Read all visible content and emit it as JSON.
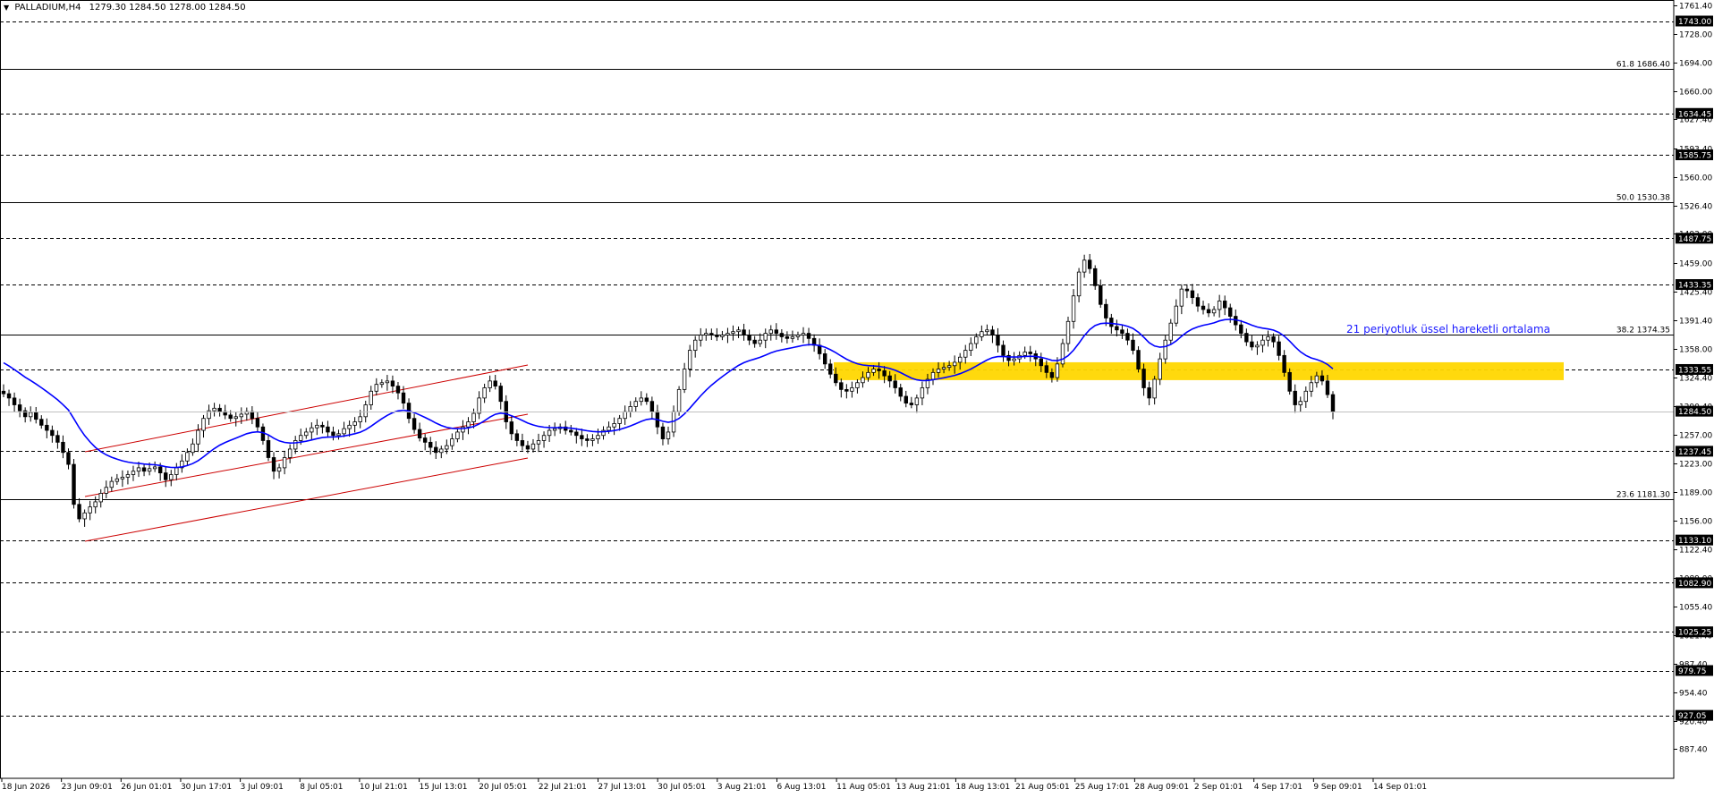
{
  "header": {
    "symbol": "PALLADIUM,H4",
    "ohlc": "1279.30 1284.50 1278.00 1284.50"
  },
  "colors": {
    "candle": "#000000",
    "ema": "#0000ff",
    "channel": "#cc0000",
    "zone": "#ffd700",
    "annotation": "#1a1aff",
    "last_price_line": "#c0c0c0"
  },
  "annotation_text": "21 periyotluk üssel hareketli ortalama",
  "chart_data": {
    "type": "candlestick",
    "ylim": [
      861.5,
      1761.4
    ],
    "yticks": [
      1761.4,
      1728.0,
      1694.0,
      1660.0,
      1627.4,
      1593.4,
      1560.0,
      1526.4,
      1493.0,
      1459.0,
      1425.4,
      1391.4,
      1358.0,
      1324.4,
      1290.4,
      1257.0,
      1223.0,
      1189.0,
      1156.0,
      1122.4,
      1089.0,
      1055.4,
      1021.4,
      987.4,
      954.4,
      920.4,
      887.4
    ],
    "x_labels": [
      "18 Jun 2026",
      "23 Jun 09:01",
      "26 Jun 01:01",
      "30 Jun 17:01",
      "3 Jul 09:01",
      "8 Jul 05:01",
      "10 Jul 21:01",
      "15 Jul 13:01",
      "20 Jul 05:01",
      "22 Jul 21:01",
      "27 Jul 13:01",
      "30 Jul 05:01",
      "3 Aug 21:01",
      "6 Aug 13:01",
      "11 Aug 05:01",
      "13 Aug 21:01",
      "18 Aug 13:01",
      "21 Aug 05:01",
      "25 Aug 17:01",
      "28 Aug 09:01",
      "2 Sep 01:01",
      "4 Sep 17:01",
      "9 Sep 09:01",
      "14 Sep 01:01"
    ],
    "last_price": 1284.5,
    "fib_levels": [
      {
        "label": "61.8 1686.40",
        "value": 1686.4
      },
      {
        "label": "50.0 1530.38",
        "value": 1530.38
      },
      {
        "label": "38.2 1374.35",
        "value": 1374.35
      },
      {
        "label": "23.6 1181.30",
        "value": 1181.3
      }
    ],
    "sr_levels": [
      {
        "label": "1743.00",
        "value": 1743.0
      },
      {
        "label": "1634.45",
        "value": 1634.45
      },
      {
        "label": "1585.75",
        "value": 1585.75
      },
      {
        "label": "1487.75",
        "value": 1487.75
      },
      {
        "label": "1433.35",
        "value": 1433.35
      },
      {
        "label": "1333.55",
        "value": 1333.55
      },
      {
        "label": "1237.45",
        "value": 1237.45
      },
      {
        "label": "1133.10",
        "value": 1133.1
      },
      {
        "label": "1082.90",
        "value": 1082.9
      },
      {
        "label": "1025.25",
        "value": 1025.25
      },
      {
        "label": "979.75",
        "value": 979.75
      },
      {
        "label": "927.05",
        "value": 927.05
      }
    ],
    "zone": {
      "y_from": 1321,
      "y_to": 1342
    },
    "series_close": [
      1305,
      1300,
      1292,
      1285,
      1278,
      1283,
      1275,
      1268,
      1262,
      1256,
      1248,
      1236,
      1222,
      1175,
      1158,
      1165,
      1172,
      1178,
      1188,
      1195,
      1202,
      1205,
      1207,
      1210,
      1214,
      1218,
      1214,
      1217,
      1219,
      1212,
      1204,
      1210,
      1218,
      1226,
      1236,
      1246,
      1262,
      1276,
      1285,
      1288,
      1284,
      1280,
      1276,
      1278,
      1281,
      1284,
      1276,
      1266,
      1250,
      1230,
      1214,
      1218,
      1230,
      1240,
      1250,
      1256,
      1260,
      1265,
      1268,
      1266,
      1260,
      1256,
      1258,
      1264,
      1268,
      1272,
      1278,
      1292,
      1308,
      1316,
      1318,
      1320,
      1314,
      1306,
      1294,
      1276,
      1263,
      1253,
      1248,
      1242,
      1236,
      1240,
      1244,
      1252,
      1260,
      1266,
      1272,
      1282,
      1300,
      1312,
      1320,
      1314,
      1296,
      1272,
      1258,
      1250,
      1244,
      1240,
      1246,
      1250,
      1256,
      1262,
      1264,
      1266,
      1262,
      1260,
      1256,
      1252,
      1250,
      1252,
      1256,
      1262,
      1266,
      1270,
      1276,
      1284,
      1290,
      1296,
      1300,
      1296,
      1284,
      1266,
      1252,
      1260,
      1284,
      1310,
      1334,
      1356,
      1368,
      1374,
      1376,
      1374,
      1372,
      1374,
      1376,
      1378,
      1380,
      1374,
      1368,
      1364,
      1368,
      1376,
      1380,
      1376,
      1372,
      1370,
      1372,
      1374,
      1376,
      1370,
      1362,
      1352,
      1340,
      1328,
      1318,
      1310,
      1308,
      1312,
      1318,
      1324,
      1330,
      1334,
      1332,
      1326,
      1320,
      1312,
      1302,
      1294,
      1292,
      1300,
      1312,
      1322,
      1330,
      1334,
      1336,
      1338,
      1342,
      1348,
      1356,
      1364,
      1372,
      1378,
      1380,
      1374,
      1362,
      1350,
      1344,
      1346,
      1350,
      1354,
      1352,
      1346,
      1338,
      1330,
      1324,
      1340,
      1364,
      1390,
      1420,
      1448,
      1462,
      1452,
      1432,
      1410,
      1394,
      1384,
      1380,
      1376,
      1368,
      1356,
      1334,
      1312,
      1300,
      1322,
      1346,
      1368,
      1388,
      1408,
      1428,
      1426,
      1418,
      1408,
      1404,
      1400,
      1404,
      1414,
      1406,
      1396,
      1386,
      1376,
      1366,
      1360,
      1362,
      1368,
      1372,
      1366,
      1350,
      1330,
      1308,
      1292,
      1296,
      1308,
      1318,
      1326,
      1320,
      1304,
      1284.5
    ]
  }
}
